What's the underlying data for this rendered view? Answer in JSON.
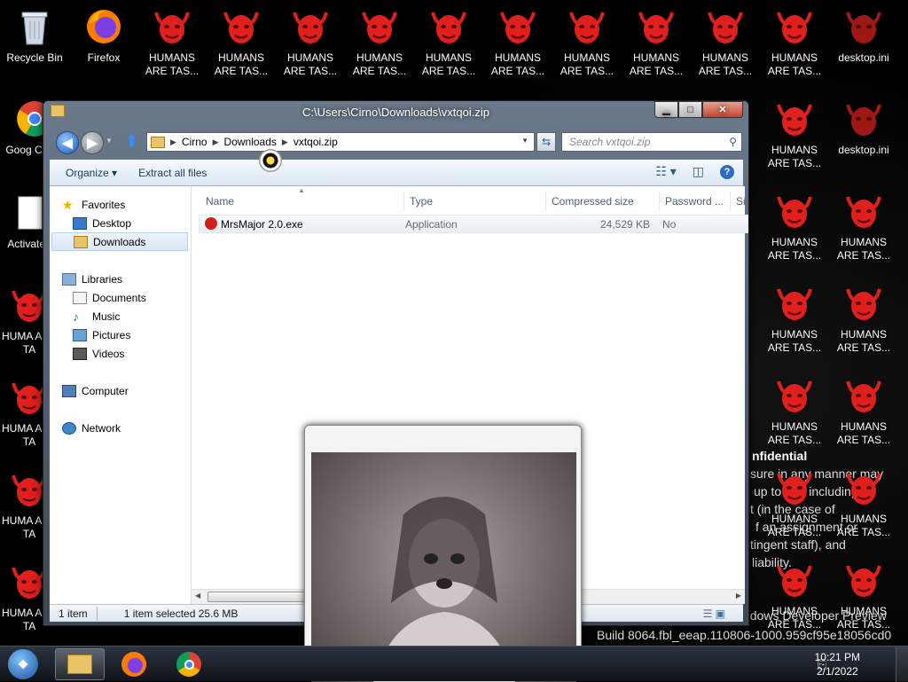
{
  "desktop": {
    "icons": [
      {
        "label": "Recycle Bin",
        "icon": "recycle-bin-icon"
      },
      {
        "label": "Firefox",
        "icon": "firefox-icon"
      },
      {
        "label": "HUMANS ARE TAS...",
        "icon": "demon-face-icon"
      },
      {
        "label": "desktop.ini",
        "icon": "demon-face-icon"
      },
      {
        "label": "Goog Chron",
        "icon": "chrome-icon"
      },
      {
        "label": "Activated",
        "icon": "blank-file-icon"
      },
      {
        "label": "HUMA ARE TA",
        "icon": "demon-face-icon"
      }
    ],
    "background_text": [
      "nfidential",
      "sure in any manner may",
      "up to and including",
      "t (in the case of",
      "f an assignment or",
      "tingent staff), and",
      "liability.",
      "ndows Developer Preview",
      "Build 8064.fbl_eeap.110806-1000.959cf95e18056cd0"
    ]
  },
  "explorer": {
    "title": "C:\\Users\\Cirno\\Downloads\\vxtqoi.zip",
    "address": {
      "segments": [
        "Cirno",
        "Downloads",
        "vxtqoi.zip"
      ]
    },
    "search_placeholder": "Search vxtqoi.zip",
    "toolbar": {
      "organize": "Organize ▾",
      "extract_all": "Extract all files"
    },
    "nav": {
      "favorites": "Favorites",
      "desktop": "Desktop",
      "downloads": "Downloads",
      "libraries": "Libraries",
      "documents": "Documents",
      "music": "Music",
      "pictures": "Pictures",
      "videos": "Videos",
      "computer": "Computer",
      "network": "Network"
    },
    "columns": {
      "name": "Name",
      "type": "Type",
      "compressed_size": "Compressed size",
      "password": "Password ...",
      "size_trunc": "Si"
    },
    "file": {
      "name": "MrsMajor 2.0.exe",
      "type": "Application",
      "compressed_size": "24,529 KB",
      "password": "No"
    },
    "status": {
      "count": "1 item",
      "selected": "1 item selected  25.6 MB"
    }
  },
  "taskbar": {
    "time": "10:21 PM",
    "date": "2/1/2022"
  },
  "colors": {
    "accent": "#1b5fb8",
    "demon": "#e0201c"
  }
}
